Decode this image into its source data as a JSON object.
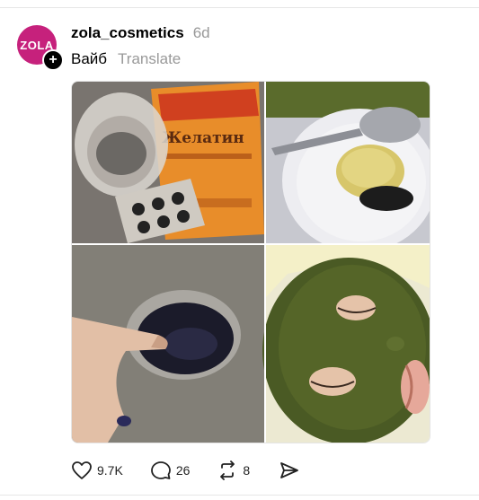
{
  "post": {
    "author": {
      "username": "zola_cosmetics",
      "avatar_text": "ZOLA",
      "avatar_color": "#c6217c"
    },
    "timestamp": "6d",
    "caption": "Вайб",
    "translate_label": "Translate",
    "image_panels": [
      {
        "description_icon": "gelatin-packet-photo"
      },
      {
        "description_icon": "spoon-bowl-photo"
      },
      {
        "description_icon": "mixing-mask-photo"
      },
      {
        "description_icon": "face-mask-photo"
      }
    ],
    "product_text": "Желатин",
    "actions": {
      "likes": "9.7K",
      "comments": "26",
      "reposts": "8"
    }
  },
  "icons": {
    "like": "heart-icon",
    "comment": "comment-icon",
    "repost": "repost-icon",
    "share": "share-icon",
    "follow": "plus-icon"
  }
}
